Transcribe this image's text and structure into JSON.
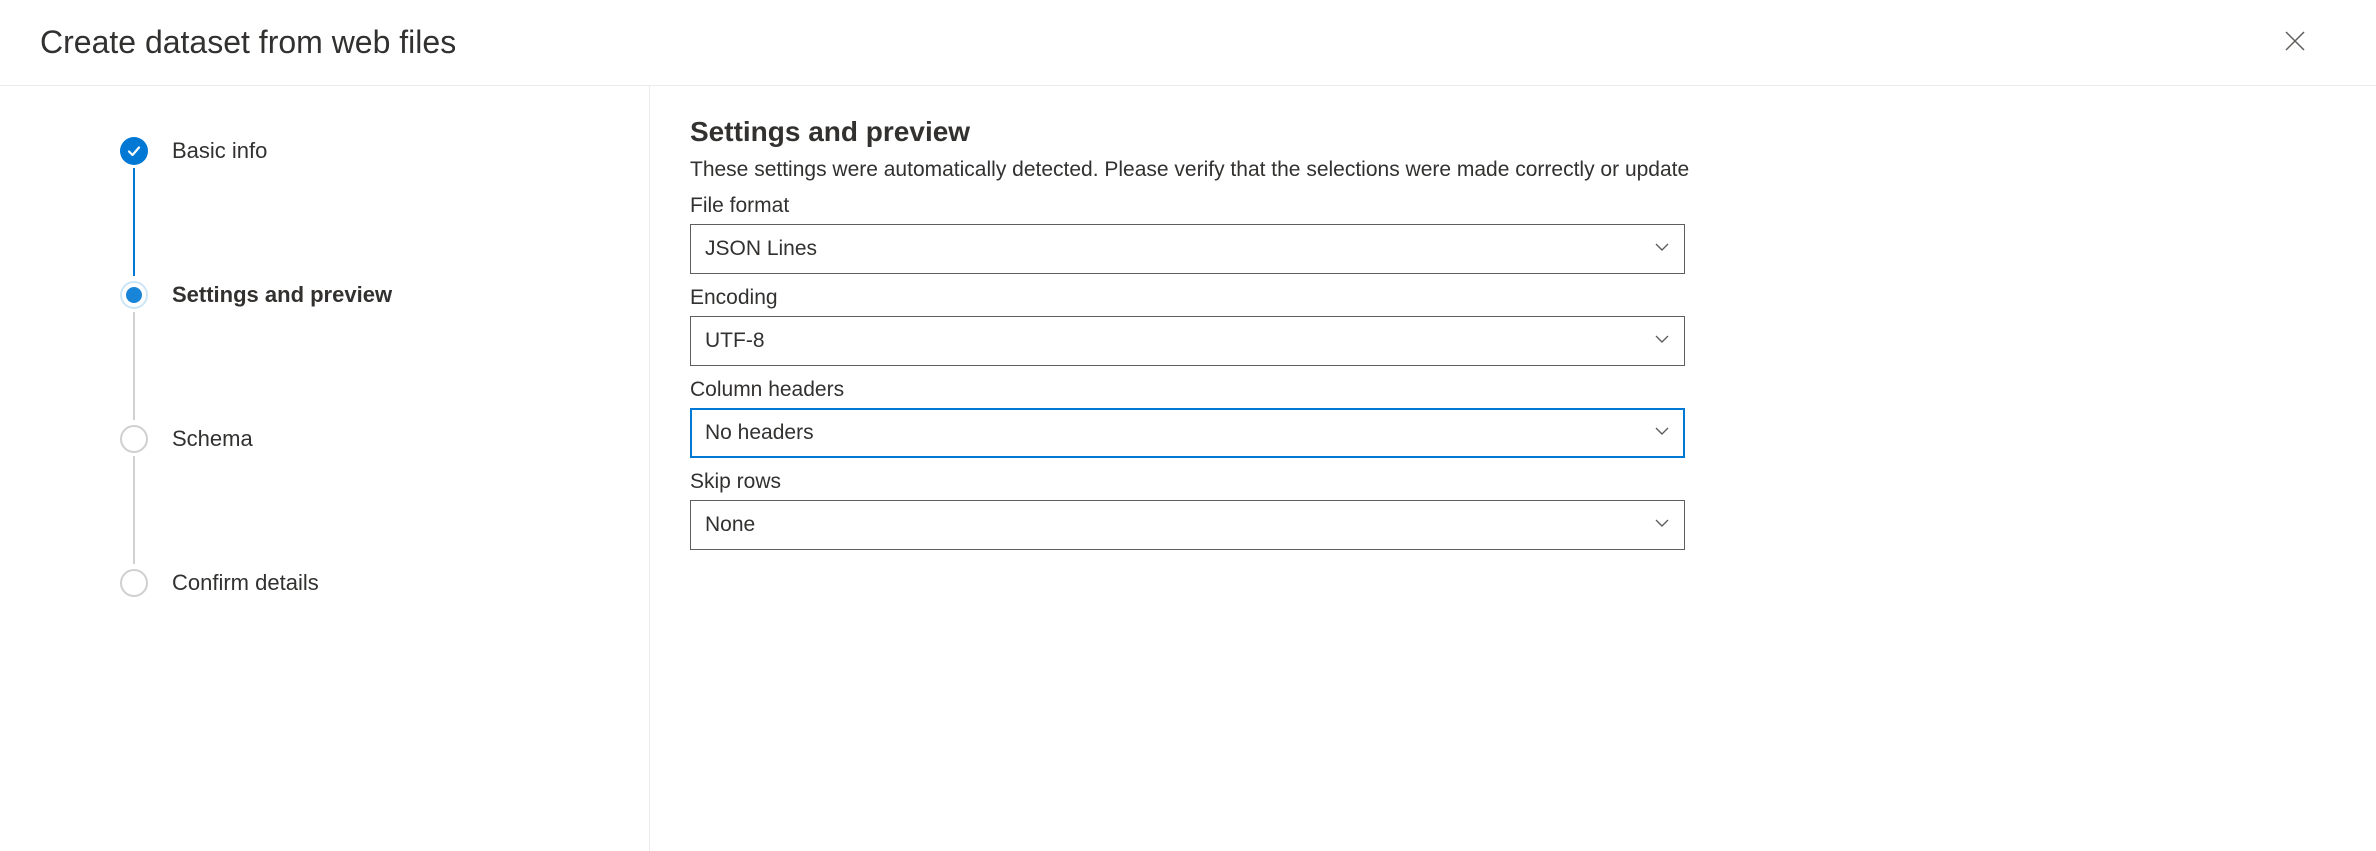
{
  "header": {
    "title": "Create dataset from web files"
  },
  "steps": [
    {
      "label": "Basic info"
    },
    {
      "label": "Settings and preview"
    },
    {
      "label": "Schema"
    },
    {
      "label": "Confirm details"
    }
  ],
  "panel": {
    "heading": "Settings and preview",
    "description": "These settings were automatically detected. Please verify that the selections were made correctly or update",
    "fields": {
      "file_format": {
        "label": "File format",
        "value": "JSON Lines"
      },
      "encoding": {
        "label": "Encoding",
        "value": "UTF-8"
      },
      "column_headers": {
        "label": "Column headers",
        "value": "No headers"
      },
      "skip_rows": {
        "label": "Skip rows",
        "value": "None"
      }
    }
  }
}
